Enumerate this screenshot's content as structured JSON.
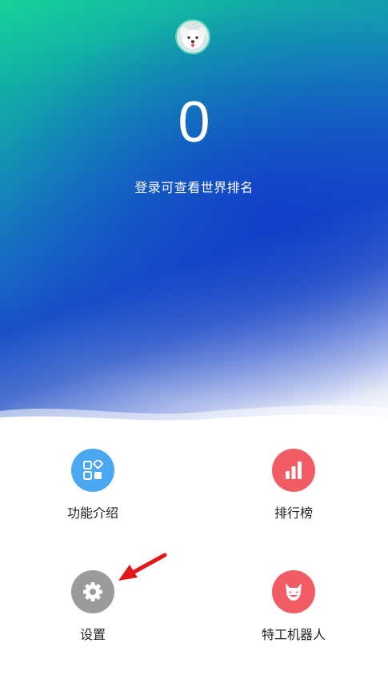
{
  "profile": {
    "score": "0",
    "login_hint": "登录可查看世界排名",
    "avatar_icon": "dog-avatar-icon"
  },
  "menu": [
    {
      "label": "功能介绍",
      "icon": "grid-icon",
      "color": "#4aa8f2"
    },
    {
      "label": "排行榜",
      "icon": "bar-chart-icon",
      "color": "#f25c64"
    },
    {
      "label": "设置",
      "icon": "gear-icon",
      "color": "#9b9b9b"
    },
    {
      "label": "特工机器人",
      "icon": "devil-icon",
      "color": "#f25c64"
    }
  ],
  "colors": {
    "hero_top": "#16d39a",
    "hero_mid": "#1850c8",
    "annotation_arrow": "#e01818"
  }
}
